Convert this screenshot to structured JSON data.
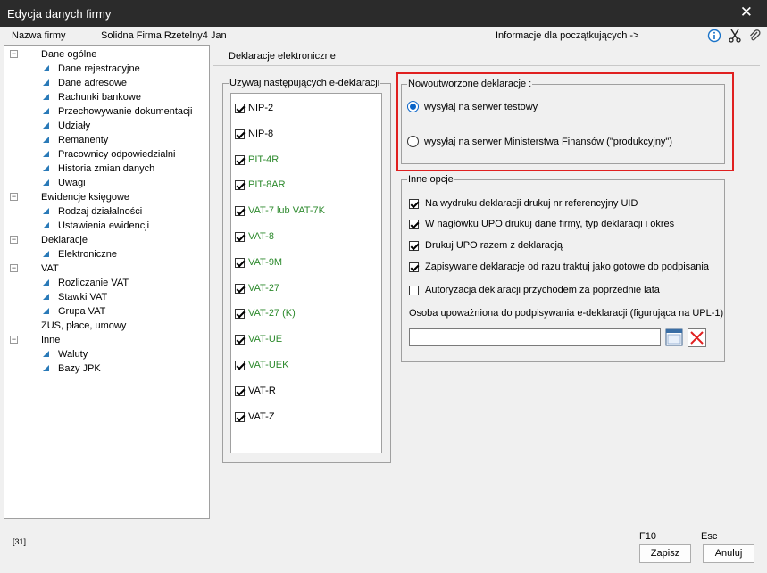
{
  "window": {
    "title": "Edycja danych firmy"
  },
  "header": {
    "company_label": "Nazwa firmy",
    "company_name": "Solidna Firma Rzetelny4 Jan",
    "beginners_link": "Informacje dla początkujących ->"
  },
  "tree": {
    "nodes": [
      {
        "label": "Dane ogólne",
        "type": "group"
      },
      {
        "label": "Dane rejestracyjne",
        "type": "leaf"
      },
      {
        "label": "Dane adresowe",
        "type": "leaf"
      },
      {
        "label": "Rachunki bankowe",
        "type": "leaf"
      },
      {
        "label": "Przechowywanie dokumentacji",
        "type": "leaf"
      },
      {
        "label": "Udziały",
        "type": "leaf"
      },
      {
        "label": "Remanenty",
        "type": "leaf"
      },
      {
        "label": "Pracownicy odpowiedzialni",
        "type": "leaf"
      },
      {
        "label": "Historia zmian danych",
        "type": "leaf"
      },
      {
        "label": "Uwagi",
        "type": "leaf"
      },
      {
        "label": "Ewidencje księgowe",
        "type": "group"
      },
      {
        "label": "Rodzaj działalności",
        "type": "leaf"
      },
      {
        "label": "Ustawienia ewidencji",
        "type": "leaf"
      },
      {
        "label": "Deklaracje",
        "type": "group"
      },
      {
        "label": "Elektroniczne",
        "type": "leaf"
      },
      {
        "label": "VAT",
        "type": "group"
      },
      {
        "label": "Rozliczanie VAT",
        "type": "leaf"
      },
      {
        "label": "Stawki VAT",
        "type": "leaf"
      },
      {
        "label": "Grupa VAT",
        "type": "leaf"
      },
      {
        "label": "ZUS, płace, umowy",
        "type": "item"
      },
      {
        "label": "Inne",
        "type": "group"
      },
      {
        "label": "Waluty",
        "type": "leaf"
      },
      {
        "label": "Bazy JPK",
        "type": "leaf"
      }
    ]
  },
  "panel": {
    "title": "Deklaracje elektroniczne"
  },
  "declarations": {
    "legend": "Używaj następujących e-deklaracji",
    "items": [
      {
        "label": "NIP-2",
        "checked": true,
        "green": false
      },
      {
        "label": "NIP-8",
        "checked": true,
        "green": false
      },
      {
        "label": "PIT-4R",
        "checked": true,
        "green": true
      },
      {
        "label": "PIT-8AR",
        "checked": true,
        "green": true
      },
      {
        "label": "VAT-7 lub VAT-7K",
        "checked": true,
        "green": true
      },
      {
        "label": "VAT-8",
        "checked": true,
        "green": true
      },
      {
        "label": "VAT-9M",
        "checked": true,
        "green": true
      },
      {
        "label": "VAT-27",
        "checked": true,
        "green": true
      },
      {
        "label": "VAT-27 (K)",
        "checked": true,
        "green": true
      },
      {
        "label": "VAT-UE",
        "checked": true,
        "green": true
      },
      {
        "label": "VAT-UEK",
        "checked": true,
        "green": true
      },
      {
        "label": "VAT-R",
        "checked": true,
        "green": false
      },
      {
        "label": "VAT-Z",
        "checked": true,
        "green": false
      }
    ]
  },
  "new_declarations": {
    "legend": "Nowoutworzone deklaracje :",
    "options": [
      {
        "label": "wysyłaj na serwer testowy",
        "selected": true
      },
      {
        "label": "wysyłaj na serwer Ministerstwa Finansów (\"produkcyjny\")",
        "selected": false
      }
    ]
  },
  "other_options": {
    "legend": "Inne opcje",
    "items": [
      {
        "label": "Na wydruku deklaracji drukuj nr referencyjny UID",
        "checked": true
      },
      {
        "label": "W nagłówku UPO drukuj dane firmy, typ deklaracji i okres",
        "checked": true
      },
      {
        "label": "Drukuj UPO razem z deklaracją",
        "checked": true
      },
      {
        "label": "Zapisywane deklaracje od razu traktuj jako gotowe do podpisania",
        "checked": true
      },
      {
        "label": "Autoryzacja deklaracji przychodem za poprzednie lata",
        "checked": false
      }
    ],
    "signer_label": "Osoba upoważniona do podpisywania e-deklaracji (figurująca na UPL-1)",
    "signer_value": ""
  },
  "footer": {
    "code": "[31]",
    "save_key": "F10",
    "save_label": "Zapisz",
    "cancel_key": "Esc",
    "cancel_label": "Anuluj"
  },
  "colors": {
    "accent": "#0a64c8",
    "green_item": "#2d8a2d",
    "highlight": "#e02020"
  }
}
